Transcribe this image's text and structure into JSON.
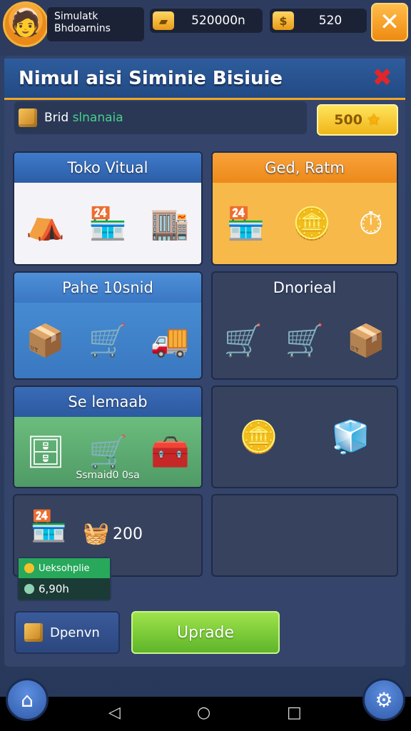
{
  "hud": {
    "player_line1": "Simulatk",
    "player_line2": "Bhdoarnins",
    "resource1_icon": "gold-bar-icon",
    "resource1_value": "520000n",
    "resource2_icon": "coin-icon",
    "resource2_value": "520",
    "close_label": "✕"
  },
  "panel": {
    "title": "Nimul aisi Siminie Bisiuie",
    "close_label": "✖",
    "info_label_a": "Brid",
    "info_label_b": "slnanaia",
    "gold_button_value": "500",
    "gold_button_star": "★"
  },
  "cards": {
    "toko_virtual": {
      "title": "Toko Vitual"
    },
    "ged_ratm": {
      "title": "Ged, Ratm"
    },
    "pahe": {
      "title": "Pahe 10snid"
    },
    "dnorieal": {
      "title": "Dnorieal"
    },
    "se_lemaab": {
      "title": "Se lemaab",
      "footer": "Ssmaid0 0sa"
    },
    "shop_card": {
      "amount": "200"
    }
  },
  "mini_panel": {
    "row1": "Ueksohplie",
    "row2": "6,90h"
  },
  "buttons": {
    "dpenvn": "Dpenvn",
    "upgrade": "Uprade"
  },
  "colors": {
    "accent_orange": "#f0a626",
    "upgrade_green": "#7ccc3a",
    "title_blue": "#2e5c9c"
  }
}
